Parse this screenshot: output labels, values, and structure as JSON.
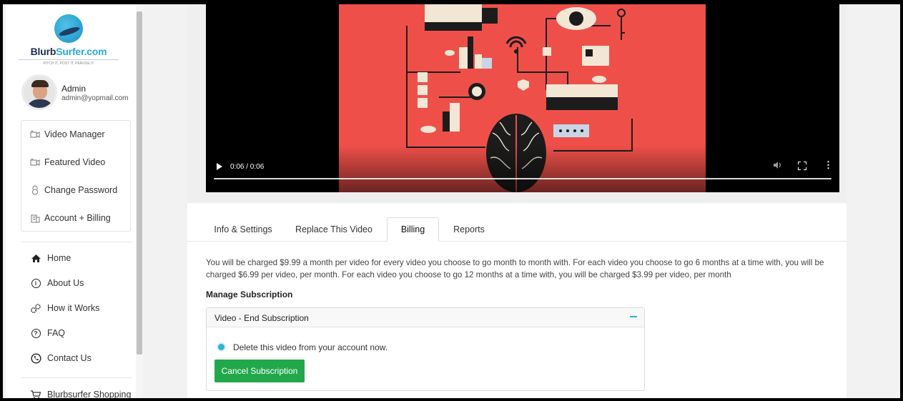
{
  "brand": {
    "name_part1": "Blurb",
    "name_part2": "Surfer.com",
    "tagline": "PITCH IT, POST IT, PERUSE IT"
  },
  "profile": {
    "name": "Admin",
    "email": "admin@yopmail.com"
  },
  "account_menu": [
    {
      "label": "Video Manager",
      "icon": "video-camera-icon"
    },
    {
      "label": "Featured Video",
      "icon": "video-camera-icon"
    },
    {
      "label": "Change Password",
      "icon": "lock-icon"
    },
    {
      "label": "Account + Billing",
      "icon": "building-icon"
    }
  ],
  "nav": [
    {
      "label": "Home",
      "icon": "home-icon"
    },
    {
      "label": "About Us",
      "icon": "info-icon"
    },
    {
      "label": "How it Works",
      "icon": "gears-icon"
    },
    {
      "label": "FAQ",
      "icon": "question-icon"
    },
    {
      "label": "Contact Us",
      "icon": "phone-icon"
    },
    {
      "label": "Blurbsurfer Shopping",
      "icon": "cart-icon"
    }
  ],
  "video": {
    "time": "0:06 / 0:06",
    "progress": 1.0
  },
  "tabs": [
    {
      "label": "Info & Settings",
      "active": false
    },
    {
      "label": "Replace This Video",
      "active": false
    },
    {
      "label": "Billing",
      "active": true
    },
    {
      "label": "Reports",
      "active": false
    }
  ],
  "billing": {
    "description": "You will be charged $9.99 a month per video for every video you choose to go month to month with. For each video you choose to go 6 months at a time with, you will be charged $6.99 per video, per month. For each video you choose to go 12 months at a time with, you will be charged $3.99 per video, per month",
    "manage_title": "Manage Subscription",
    "panel_title": "Video - End Subscription",
    "option_label": "Delete this video from your account now.",
    "cancel_button": "Cancel Subscription"
  },
  "colors": {
    "accent": "#29b6d6",
    "cancel_button": "#22a84a",
    "poster_bg": "#ee5049"
  }
}
